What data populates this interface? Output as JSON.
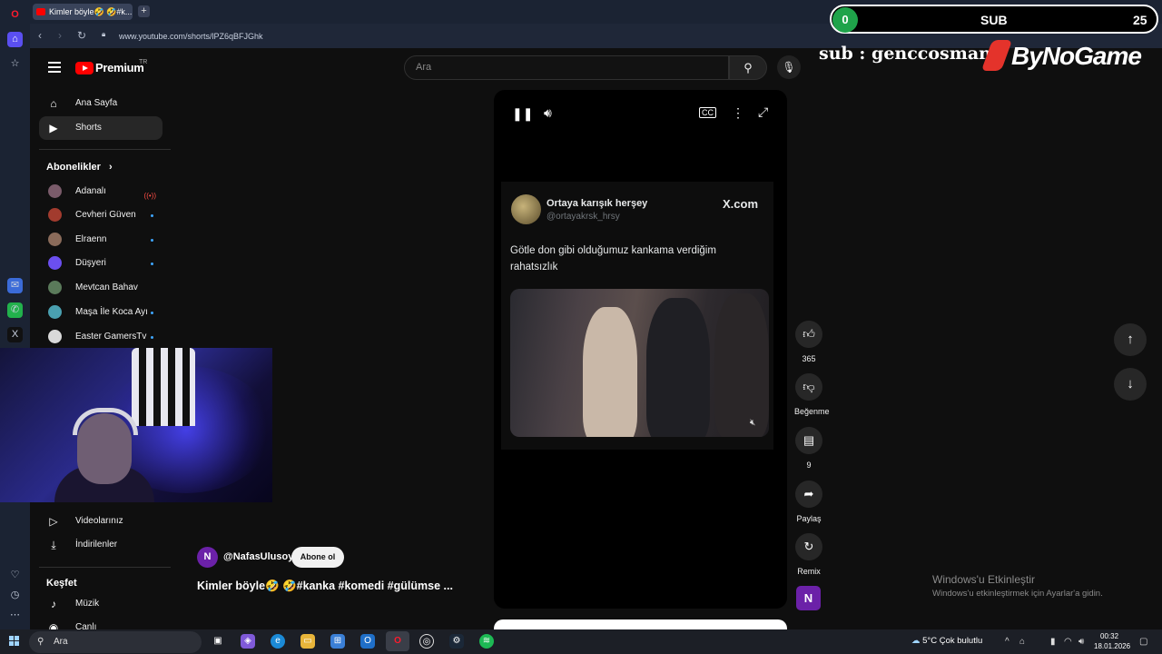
{
  "browser": {
    "tab_title": "Kimler böyle🤣 🤣#k...",
    "url": "www.youtube.com/shorts/lPZ6qBFJGhk"
  },
  "overlay": {
    "sub_left_count": "0",
    "sub_label": "SUB",
    "sub_right_count": "25",
    "credit": "sub : genccosman",
    "brand": "ByNoGame"
  },
  "youtube": {
    "logo_text": "Premium",
    "logo_region": "TR",
    "search_placeholder": "Ara"
  },
  "nav": {
    "home": "Ana Sayfa",
    "shorts": "Shorts",
    "subscriptions_title": "Abonelikler",
    "subscriptions": [
      {
        "name": "Adanalı",
        "color": "#7a5b6a"
      },
      {
        "name": "Cevheri Güven",
        "color": "#a23b2e"
      },
      {
        "name": "Elraenn",
        "color": "#8a6b5a"
      },
      {
        "name": "Düşyeri",
        "color": "#6b4ff0"
      },
      {
        "name": "Mevtcan Bahav",
        "color": "#5a7a5a"
      },
      {
        "name": "Maşa İle Koca Ayı",
        "color": "#4aa0b0"
      },
      {
        "name": "Easter GamersTv",
        "color": "#d9d9d9"
      }
    ],
    "your_videos": "Videolarınız",
    "downloads": "İndirilenler",
    "explore_title": "Keşfet",
    "music": "Müzik",
    "live": "Canlı"
  },
  "tweet": {
    "name": "Ortaya karışık herşey",
    "handle": "@ortayakrsk_hrsy",
    "source": "X.com",
    "text": "Götle don gibi olduğumuz kankama verdiğim rahatsızlık"
  },
  "actions": {
    "likes": "365",
    "dislike_label": "Beğenme",
    "comments": "9",
    "share_label": "Paylaş",
    "remix_label": "Remix",
    "remix_avatar": "N"
  },
  "channel": {
    "avatar_letter": "N",
    "handle": "@NafasUlusoy",
    "subscribe_label": "Abone ol",
    "video_title": "Kimler böyle🤣 🤣#kanka #komedi #gülümse ..."
  },
  "watermark": {
    "line1": "Windows'u Etkinleştir",
    "line2": "Windows'u etkinleştirmek için Ayarlar'a gidin."
  },
  "taskbar": {
    "search_label": "Ara",
    "weather": "5°C  Çok bulutlu",
    "time": "00:32",
    "date": "18.01.2026"
  }
}
